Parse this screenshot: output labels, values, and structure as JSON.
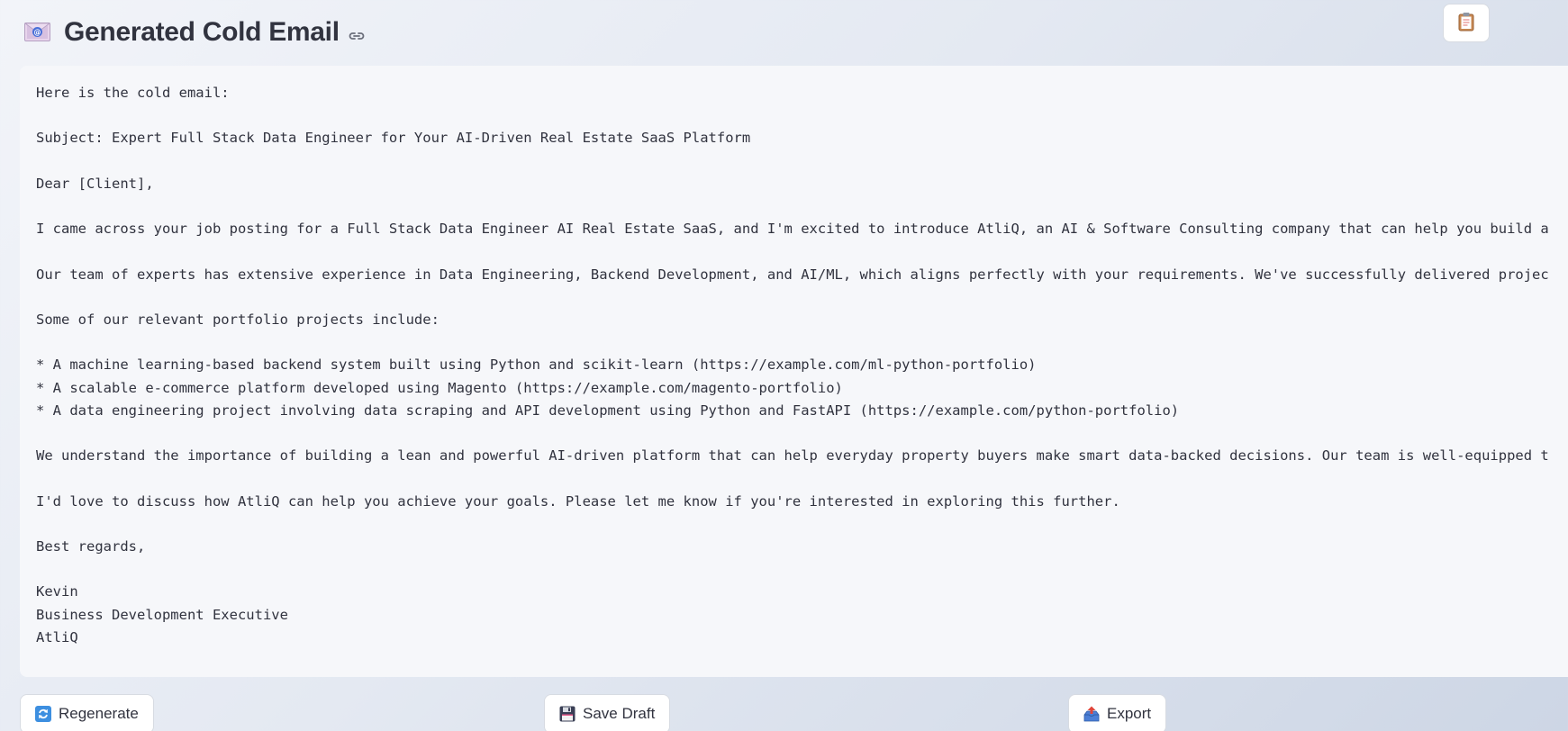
{
  "header": {
    "title": "Generated Cold Email",
    "title_icon": "envelope-at-icon",
    "anchor_icon": "link-icon"
  },
  "toolbar": {
    "copy_icon": "clipboard-icon"
  },
  "email": {
    "lines": [
      "Here is the cold email:",
      "",
      "Subject: Expert Full Stack Data Engineer for Your AI-Driven Real Estate SaaS Platform",
      "",
      "Dear [Client],",
      "",
      "I came across your job posting for a Full Stack Data Engineer AI Real Estate SaaS, and I'm excited to introduce AtliQ, an AI & Software Consulting company that can help you build a",
      "",
      "Our team of experts has extensive experience in Data Engineering, Backend Development, and AI/ML, which aligns perfectly with your requirements. We've successfully delivered projec",
      "",
      "Some of our relevant portfolio projects include:",
      "",
      "* A machine learning-based backend system built using Python and scikit-learn (https://example.com/ml-python-portfolio)",
      "* A scalable e-commerce platform developed using Magento (https://example.com/magento-portfolio)",
      "* A data engineering project involving data scraping and API development using Python and FastAPI (https://example.com/python-portfolio)",
      "",
      "We understand the importance of building a lean and powerful AI-driven platform that can help everyday property buyers make smart data-backed decisions. Our team is well-equipped t",
      "",
      "I'd love to discuss how AtliQ can help you achieve your goals. Please let me know if you're interested in exploring this further.",
      "",
      "Best regards,",
      "",
      "Kevin",
      "Business Development Executive",
      "AtliQ"
    ]
  },
  "actions": {
    "regenerate_label": "Regenerate",
    "regenerate_icon": "refresh-icon",
    "save_label": "Save Draft",
    "save_icon": "floppy-disk-icon",
    "export_label": "Export",
    "export_icon": "outbox-tray-icon"
  },
  "colors": {
    "text": "#31333f",
    "panel": "#f6f7fa",
    "button_border": "#d7dbe2"
  }
}
